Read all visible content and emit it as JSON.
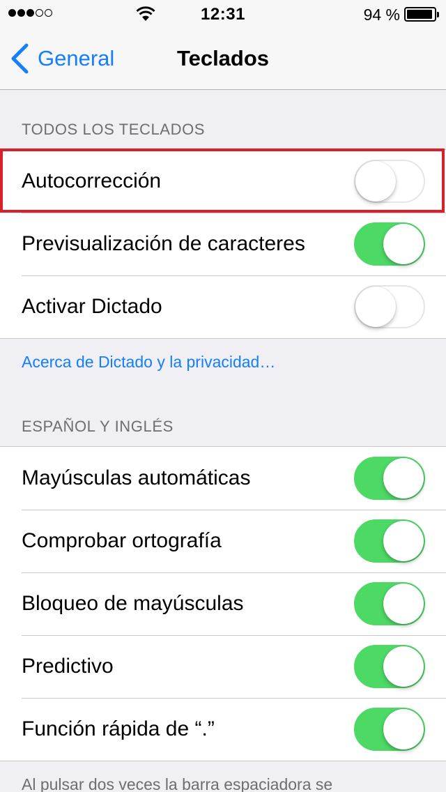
{
  "status_bar": {
    "signal_total": 5,
    "signal_on": 3,
    "time": "12:31",
    "battery_percent": "94 %",
    "battery_level": 0.94
  },
  "nav": {
    "back_label": "General",
    "title": "Teclados"
  },
  "sections": [
    {
      "header": "TODOS LOS TECLADOS",
      "rows": [
        {
          "label": "Autocorrección",
          "on": false
        },
        {
          "label": "Previsualización de caracteres",
          "on": true
        },
        {
          "label": "Activar Dictado",
          "on": false
        }
      ]
    },
    {
      "header": "ESPAÑOL Y INGLÉS",
      "rows": [
        {
          "label": "Mayúsculas automáticas",
          "on": true
        },
        {
          "label": "Comprobar ortografía",
          "on": true
        },
        {
          "label": "Bloqueo de mayúsculas",
          "on": true
        },
        {
          "label": "Predictivo",
          "on": true
        },
        {
          "label": "Función rápida de “.”",
          "on": true
        }
      ]
    }
  ],
  "dictation_link": "Acerca de Dictado y la privacidad…",
  "footer_note": "Al pulsar dos veces la barra espaciadora se",
  "colors": {
    "accent": "#147efb",
    "toggle_on": "#4cd964",
    "highlight": "#d81f2a"
  }
}
